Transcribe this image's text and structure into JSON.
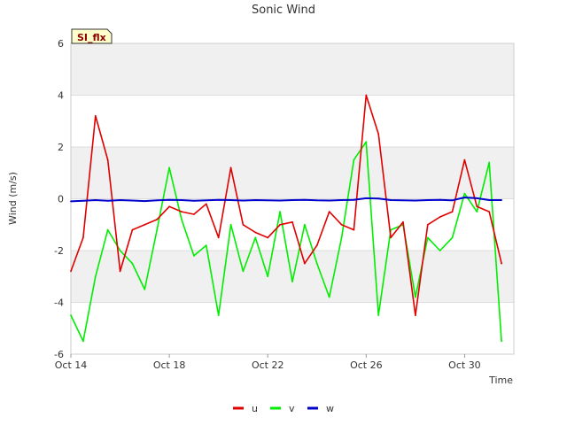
{
  "site_badge": "SI_flx",
  "colors": {
    "u": "#e00000",
    "v": "#00ee00",
    "w": "#0000cc",
    "band": "#f0f0f0",
    "grid": "#dddddd"
  },
  "chart_data": {
    "type": "line",
    "title": "Sonic Wind",
    "xlabel": "Time",
    "ylabel": "Wind (m/s)",
    "xlim": [
      "2023-10-14",
      "2023-11-01"
    ],
    "ylim": [
      -6,
      6
    ],
    "x_ticks": [
      "Oct 14",
      "Oct 18",
      "Oct 22",
      "Oct 26",
      "Oct 30"
    ],
    "y_ticks": [
      "6",
      "4",
      "2",
      "0",
      "-2",
      "-4",
      "-6"
    ],
    "legend_placement": "bottom",
    "x": [
      "2023-10-14",
      "2023-10-14T12:00",
      "2023-10-15",
      "2023-10-15T12:00",
      "2023-10-16",
      "2023-10-16T12:00",
      "2023-10-17",
      "2023-10-17T12:00",
      "2023-10-18",
      "2023-10-18T12:00",
      "2023-10-19",
      "2023-10-19T12:00",
      "2023-10-20",
      "2023-10-20T12:00",
      "2023-10-21",
      "2023-10-21T12:00",
      "2023-10-22",
      "2023-10-22T12:00",
      "2023-10-23",
      "2023-10-23T12:00",
      "2023-10-24",
      "2023-10-24T12:00",
      "2023-10-25",
      "2023-10-25T12:00",
      "2023-10-26",
      "2023-10-26T12:00",
      "2023-10-27",
      "2023-10-27T12:00",
      "2023-10-28",
      "2023-10-28T12:00",
      "2023-10-29",
      "2023-10-29T12:00",
      "2023-10-30",
      "2023-10-30T12:00",
      "2023-10-31",
      "2023-10-31T12:00"
    ],
    "series": [
      {
        "name": "u",
        "values": [
          -2.8,
          -1.5,
          3.2,
          1.5,
          -2.8,
          -1.2,
          -1.0,
          -0.8,
          -0.3,
          -0.5,
          -0.6,
          -0.2,
          -1.5,
          1.2,
          -1.0,
          -1.3,
          -1.5,
          -1.0,
          -0.9,
          -2.5,
          -1.8,
          -0.5,
          -1.0,
          -1.2,
          4.0,
          2.5,
          -1.5,
          -0.9,
          -4.5,
          -1.0,
          -0.7,
          -0.5,
          1.5,
          -0.3,
          -0.5,
          -2.5
        ]
      },
      {
        "name": "v",
        "values": [
          -4.5,
          -5.5,
          -3.0,
          -1.2,
          -2.0,
          -2.5,
          -3.5,
          -1.2,
          1.2,
          -0.8,
          -2.2,
          -1.8,
          -4.5,
          -1.0,
          -2.8,
          -1.5,
          -3.0,
          -0.5,
          -3.2,
          -1.0,
          -2.5,
          -3.8,
          -1.5,
          1.5,
          2.2,
          -4.5,
          -1.2,
          -1.0,
          -3.8,
          -1.5,
          -2.0,
          -1.5,
          0.2,
          -0.5,
          1.4,
          -5.5
        ]
      },
      {
        "name": "w",
        "values": [
          -0.1,
          -0.08,
          -0.05,
          -0.08,
          -0.05,
          -0.07,
          -0.09,
          -0.06,
          -0.04,
          -0.05,
          -0.08,
          -0.06,
          -0.04,
          -0.05,
          -0.07,
          -0.05,
          -0.06,
          -0.07,
          -0.05,
          -0.04,
          -0.06,
          -0.07,
          -0.05,
          -0.04,
          0.02,
          0.01,
          -0.05,
          -0.06,
          -0.07,
          -0.05,
          -0.04,
          -0.06,
          0.05,
          0.02,
          -0.05,
          -0.05
        ]
      }
    ]
  }
}
